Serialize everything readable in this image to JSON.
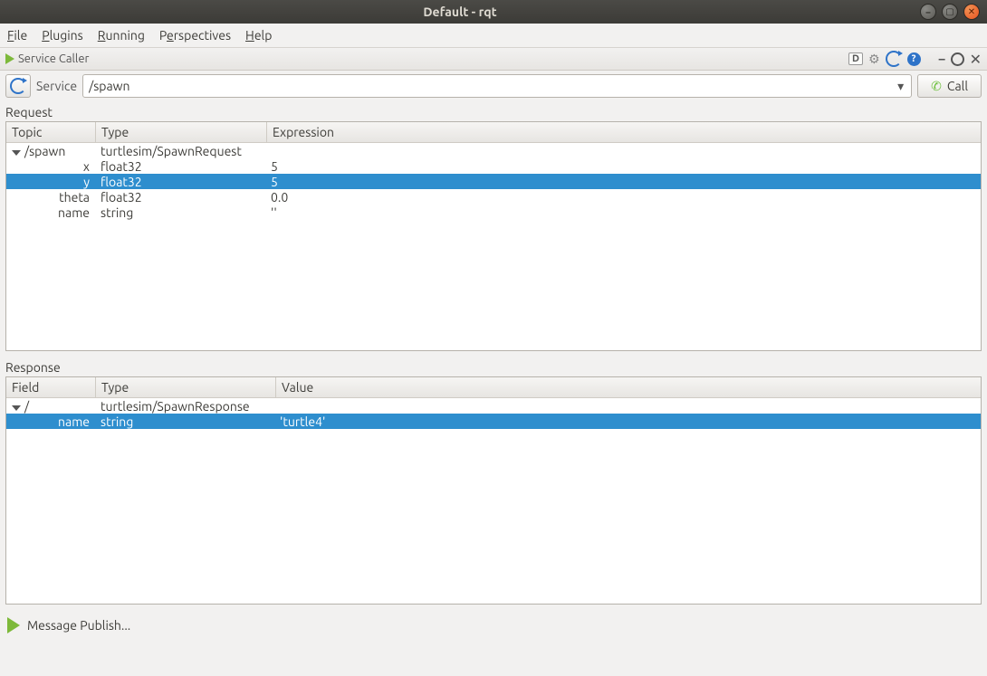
{
  "window": {
    "title": "Default - rqt"
  },
  "menubar": {
    "file": "File",
    "plugins": "Plugins",
    "running": "Running",
    "perspectives": "Perspectives",
    "help": "Help"
  },
  "plugin": {
    "title": "Service Caller"
  },
  "service": {
    "label": "Service",
    "value": "/spawn",
    "call_label": "Call"
  },
  "request": {
    "label": "Request",
    "columns": {
      "topic": "Topic",
      "type": "Type",
      "expression": "Expression"
    },
    "root": {
      "topic": "/spawn",
      "type": "turtlesim/SpawnRequest",
      "expression": ""
    },
    "rows": [
      {
        "topic": "x",
        "type": "float32",
        "expression": "5",
        "selected": false
      },
      {
        "topic": "y",
        "type": "float32",
        "expression": "5",
        "selected": true
      },
      {
        "topic": "theta",
        "type": "float32",
        "expression": "0.0",
        "selected": false
      },
      {
        "topic": "name",
        "type": "string",
        "expression": "''",
        "selected": false
      }
    ]
  },
  "response": {
    "label": "Response",
    "columns": {
      "field": "Field",
      "type": "Type",
      "value": "Value"
    },
    "root": {
      "field": "/",
      "type": "turtlesim/SpawnResponse",
      "value": ""
    },
    "rows": [
      {
        "field": "name",
        "type": "string",
        "value": "'turtle4'",
        "selected": true
      }
    ]
  },
  "bottom": {
    "message_publish": "Message Publish..."
  }
}
